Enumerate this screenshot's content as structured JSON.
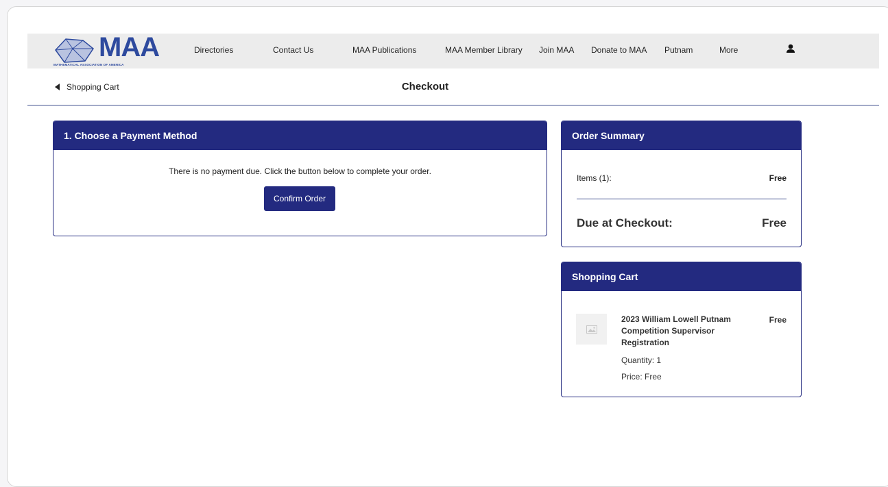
{
  "brand": {
    "logo_text": "MAA",
    "logo_subtitle": "MATHEMATICAL ASSOCIATION OF AMERICA",
    "accent": "#232a80"
  },
  "nav": {
    "items": [
      {
        "label": "Directories"
      },
      {
        "label": "Contact Us"
      },
      {
        "label": "MAA Publications"
      },
      {
        "label": "MAA Member Library"
      },
      {
        "label": "Join MAA"
      },
      {
        "label": "Donate to MAA"
      },
      {
        "label": "Putnam"
      },
      {
        "label": "More"
      }
    ],
    "user_icon": "user-icon"
  },
  "subbar": {
    "back_label": "Shopping Cart",
    "title": "Checkout"
  },
  "payment": {
    "header": "1. Choose a Payment Method",
    "message": "There is no payment due. Click the button below to complete your order.",
    "confirm_label": "Confirm Order"
  },
  "summary": {
    "header": "Order Summary",
    "items_label": "Items (1):",
    "items_value": "Free",
    "due_label": "Due at Checkout:",
    "due_value": "Free"
  },
  "cart": {
    "header": "Shopping Cart",
    "item": {
      "name": "2023 William Lowell Putnam Competition Supervisor Registration",
      "price": "Free",
      "quantity": "Quantity: 1",
      "price_line": "Price:  Free",
      "thumb_icon": "image-placeholder-icon"
    }
  }
}
